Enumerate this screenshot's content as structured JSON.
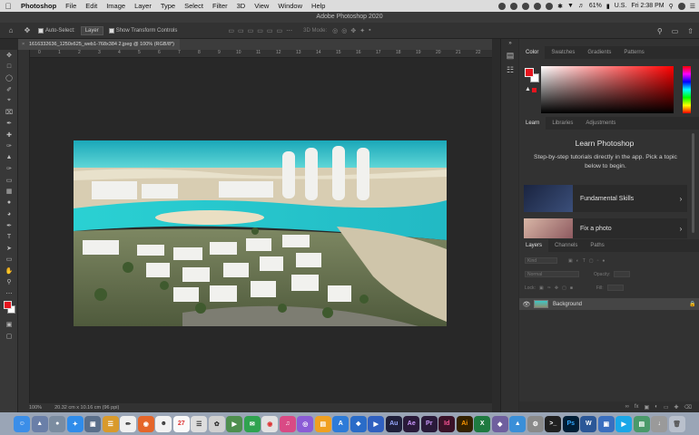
{
  "menubar": {
    "apple": "",
    "app_name": "Photoshop",
    "items": [
      "File",
      "Edit",
      "Image",
      "Layer",
      "Type",
      "Select",
      "Filter",
      "3D",
      "View",
      "Window",
      "Help"
    ],
    "battery": "61%",
    "input_source": "U.S.",
    "clock": "Fri 2:38 PM"
  },
  "window": {
    "title": "Adobe Photoshop 2020"
  },
  "options": {
    "auto_select_label": "Auto-Select:",
    "auto_select_value": "Layer",
    "transform_label": "Show Transform Controls",
    "mode_3d": "3D Mode:"
  },
  "document": {
    "tab_title": "1616332636_1250x625_web1-768x384 2.jpeg @ 100% (RGB/8*)",
    "tab_close": "×"
  },
  "ruler": {
    "ticks": [
      "0",
      "1",
      "2",
      "3",
      "4",
      "5",
      "6",
      "7",
      "8",
      "9",
      "10",
      "11",
      "12",
      "13",
      "14",
      "15",
      "16",
      "17",
      "18",
      "19",
      "20",
      "21",
      "22"
    ]
  },
  "status": {
    "zoom": "100%",
    "doc_size": "20.32 cm x 10.16 cm (96 ppi)"
  },
  "panels": {
    "color_tabs": [
      "Color",
      "Swatches",
      "Gradients",
      "Patterns"
    ],
    "learn_tabs": [
      "Learn",
      "Libraries",
      "Adjustments"
    ],
    "learn_title": "Learn Photoshop",
    "learn_desc": "Step-by-step tutorials directly in the app. Pick a topic below to begin.",
    "learn_cards": [
      "Fundamental Skills",
      "Fix a photo"
    ],
    "layer_tabs": [
      "Layers",
      "Channels",
      "Paths"
    ],
    "layer_kind": "Kind",
    "blend_mode": "Normal",
    "opacity_label": "Opacity:",
    "lock_label": "Lock:",
    "fill_label": "Fill:",
    "layer_name": "Background"
  },
  "colors": {
    "foreground": "#e6141e",
    "background": "#ffffff"
  }
}
